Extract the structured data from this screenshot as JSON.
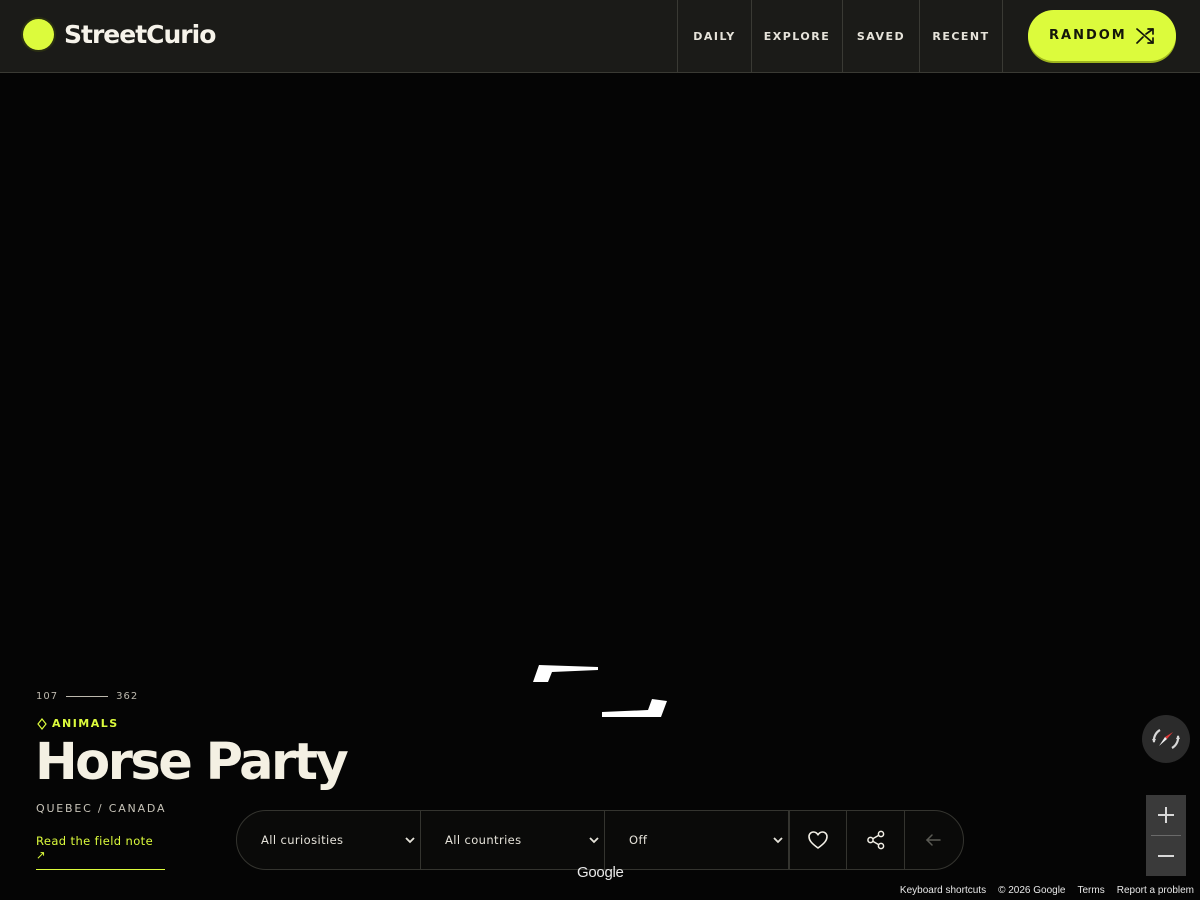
{
  "app": {
    "name": "StreetCurio"
  },
  "nav": {
    "daily": "DAILY",
    "explore": "EXPLORE",
    "saved": "SAVED",
    "recent": "RECENT"
  },
  "random_button": {
    "label": "RANDOM",
    "icon": "shuffle-icon"
  },
  "place": {
    "counter_current": "107",
    "counter_total": "362",
    "category": "ANIMALS",
    "title": "Horse Party",
    "location": "QUEBEC / CANADA",
    "field_note_link": "Read the field note ↗"
  },
  "filters": {
    "curiosity": "All curiosities",
    "country": "All countries",
    "third": "Off"
  },
  "map": {
    "logo": "Google",
    "attribution": [
      "Keyboard shortcuts",
      "© 2026 Google",
      "Terms",
      "Report a problem"
    ]
  },
  "colors": {
    "accent": "#dcfb3c",
    "header_bg": "#1b1b18",
    "canvas": "#050505"
  }
}
